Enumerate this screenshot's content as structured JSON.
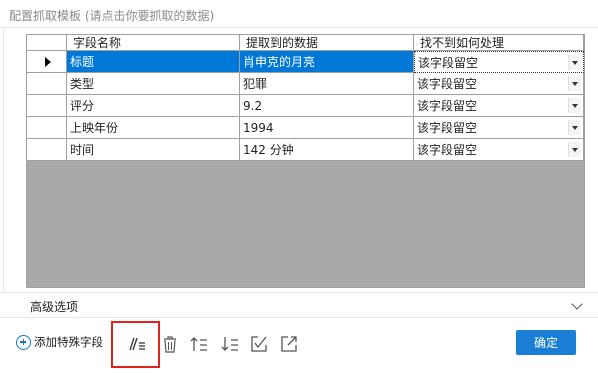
{
  "panel": {
    "title": "配置抓取模板 (请点击你要抓取的数据)"
  },
  "grid": {
    "columns": [
      "字段名称",
      "提取到的数据",
      "找不到如何处理"
    ],
    "rows": [
      {
        "name": "标题",
        "value": "肖申克的月亮",
        "action": "该字段留空"
      },
      {
        "name": "类型",
        "value": "犯罪",
        "action": "该字段留空"
      },
      {
        "name": "评分",
        "value": "9.2",
        "action": "该字段留空"
      },
      {
        "name": "上映年份",
        "value": "1994",
        "action": "该字段留空"
      },
      {
        "name": "时间",
        "value": "142 分钟",
        "action": "该字段留空"
      }
    ],
    "selected_row": 0
  },
  "advanced": {
    "label": "高级选项"
  },
  "toolbar": {
    "add_special_field": "添加特殊字段",
    "icons": [
      "edit-list-icon",
      "trash-icon",
      "move-up-icon",
      "move-down-icon",
      "check-edit-icon",
      "export-icon"
    ],
    "confirm_label": "确定"
  },
  "colors": {
    "accent": "#1a7fd4",
    "selection": "#0078d7",
    "highlight": "#e0241b"
  }
}
